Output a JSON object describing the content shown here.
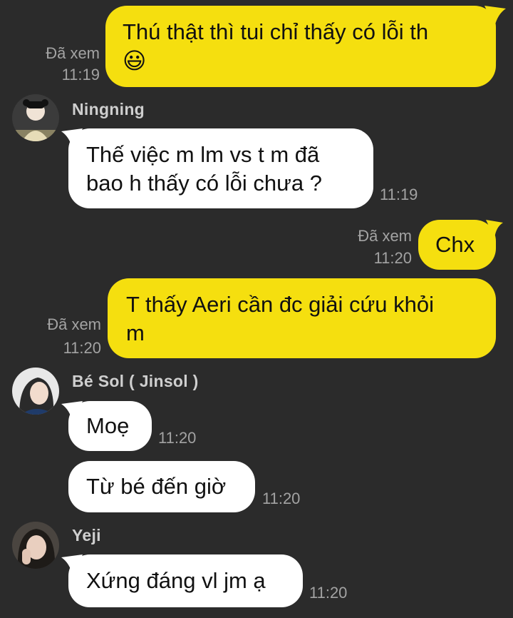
{
  "messages": [
    {
      "text": "Thú thật thì tui chỉ thấy có lỗi th",
      "emoji": "😃",
      "status": "Đã xem",
      "time": "11:19"
    },
    {
      "sender": "Ningning",
      "text_line1": "Thế việc m lm vs t m đã",
      "text_line2": "bao h thấy có lỗi chưa ?",
      "time": "11:19"
    },
    {
      "text": "Chx",
      "status": "Đã xem",
      "time": "11:20"
    },
    {
      "text_line1": "T thấy Aeri cần đc giải cứu khỏi",
      "text_line2": "m",
      "status": "Đã xem",
      "time": "11:20"
    },
    {
      "sender": "Bé Sol ( Jinsol )",
      "text": "Moẹ",
      "time": "11:20"
    },
    {
      "text": "Từ bé đến giờ",
      "time": "11:20"
    },
    {
      "sender": "Yeji",
      "text": "Xứng đáng vl jm ạ",
      "time": "11:20"
    }
  ],
  "colors": {
    "background": "#2b2b2b",
    "outgoing_bubble": "#f5df0f",
    "incoming_bubble": "#ffffff",
    "meta_text": "#a3a3a3"
  }
}
